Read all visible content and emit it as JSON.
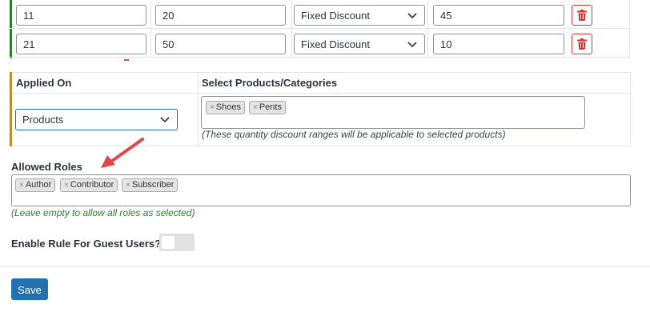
{
  "ranges": [
    {
      "min": "11",
      "max": "20",
      "type": "Fixed Discount",
      "value": "45"
    },
    {
      "min": "21",
      "max": "50",
      "type": "Fixed Discount",
      "value": "10"
    }
  ],
  "applied_on": {
    "header": "Applied On",
    "selected": "Products"
  },
  "select_products": {
    "header": "Select Products/Categories",
    "tags": [
      "Shoes",
      "Pents"
    ],
    "note": "(These quantity discount ranges will be applicable to selected products)"
  },
  "allowed_roles": {
    "label": "Allowed Roles",
    "tags": [
      "Author",
      "Contributor",
      "Subscriber"
    ],
    "note": "(Leave empty to allow all roles as selected)"
  },
  "guest": {
    "label": "Enable Rule For Guest Users?",
    "enabled": false
  },
  "save_label": "Save",
  "colors": {
    "accent": "#2271b1",
    "danger": "#d63638",
    "success_note": "#2e7d2e",
    "arrow": "#e0474c"
  }
}
